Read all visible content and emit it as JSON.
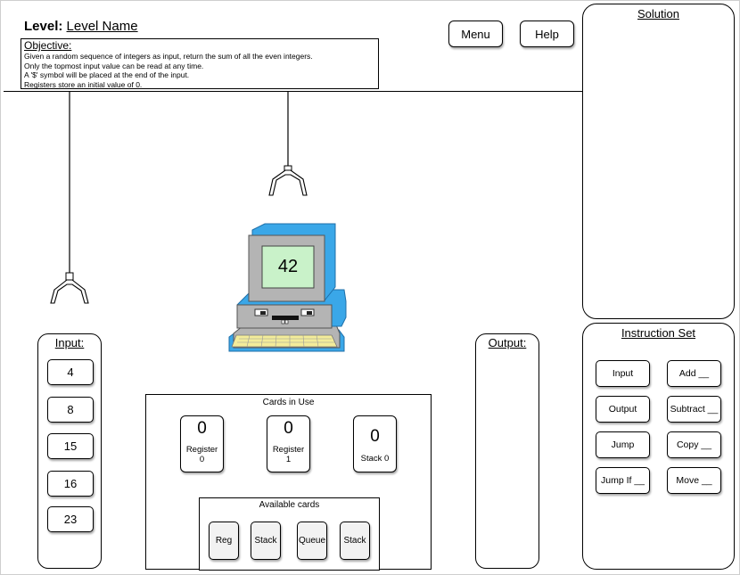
{
  "header": {
    "level_prefix": "Level:",
    "level_name": "Level Name"
  },
  "objective": {
    "heading": "Objective:",
    "lines": [
      "Given a random sequence of integers as input, return the sum of all the even integers.",
      "Only the topmost input value can be read at any time.",
      "A '$' symbol will be placed at the end of the input.",
      "Registers store an initial value of 0."
    ]
  },
  "toolbar": {
    "menu_label": "Menu",
    "help_label": "Help"
  },
  "computer": {
    "screen_value": "42"
  },
  "solution": {
    "title": "Solution"
  },
  "instruction_set": {
    "title": "Instruction Set",
    "buttons": [
      "Input",
      "Add __",
      "Output",
      "Subtract __",
      "Jump",
      "Copy __",
      "Jump  If __",
      "Move __"
    ]
  },
  "input": {
    "title": "Input:",
    "values": [
      "4",
      "8",
      "15",
      "16",
      "23"
    ]
  },
  "output": {
    "title": "Output:"
  },
  "cards_in_use": {
    "title": "Cards in Use",
    "cards": [
      {
        "value": "0",
        "label_line1": "Register",
        "label_line2": "0"
      },
      {
        "value": "0",
        "label_line1": "Register",
        "label_line2": "1"
      },
      {
        "value": "0",
        "label_line1": "Stack 0",
        "label_line2": ""
      }
    ]
  },
  "available_cards": {
    "title": "Available cards",
    "cards": [
      "Reg",
      "Stack",
      "Queue",
      "Stack"
    ]
  },
  "colors": {
    "monitor_blue": "#3aa7e8",
    "monitor_gray": "#b4b4b4",
    "screen_green": "#c9f2c9",
    "keyboard_yellow": "#f3ec9a"
  }
}
